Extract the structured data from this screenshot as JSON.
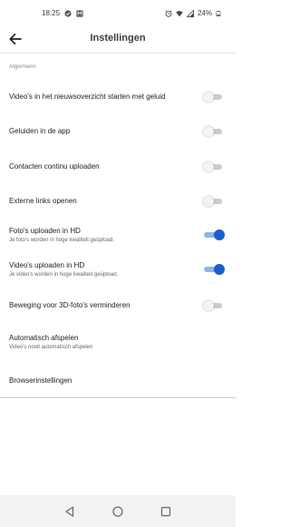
{
  "status_bar": {
    "time": "18:25",
    "battery": "24%",
    "icons": [
      "check-circle-icon",
      "app-notification-icon",
      "alarm-icon",
      "wifi-icon",
      "signal-icon",
      "battery-icon"
    ]
  },
  "app_bar": {
    "title": "Instellingen",
    "back_icon": "arrow-left-icon"
  },
  "section": {
    "header": "Algemeen"
  },
  "settings": {
    "items": [
      {
        "label": "Video's in het nieuwsoverzicht starten met geluid",
        "toggle": "off"
      },
      {
        "label": "Geluiden in de app",
        "toggle": "off"
      },
      {
        "label": "Contacten continu uploaden",
        "toggle": "off"
      },
      {
        "label": "Externe links openen",
        "toggle": "off"
      },
      {
        "label": "Foto's uploaden in HD",
        "sub": "Je foto's worden in hoge kwaliteit geüpload.",
        "toggle": "on"
      },
      {
        "label": "Video's uploaden in HD",
        "sub": "Je video's worden in hoge kwaliteit geüpload.",
        "toggle": "on"
      },
      {
        "label": "Beweging voor 3D-foto's verminderen",
        "toggle": "off"
      },
      {
        "label": "Automatisch afspelen",
        "sub": "Video's nooit automatisch afspelen"
      },
      {
        "label": "Browserinstellingen"
      }
    ]
  },
  "colors": {
    "accent": "#1a5fcf",
    "accent_track": "#8fb4ea",
    "toggle_off_track": "#c9cbcf",
    "nav_bar_bg": "#f2f2f2"
  },
  "nav_bar": {
    "icons": [
      "back-triangle-icon",
      "home-circle-icon",
      "recents-square-icon"
    ]
  }
}
